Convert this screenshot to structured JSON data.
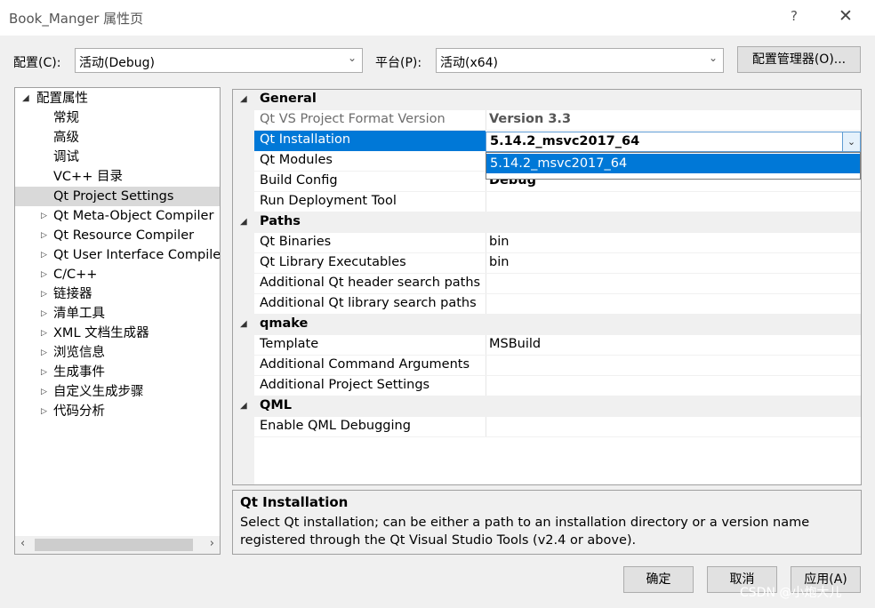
{
  "window": {
    "title": "Book_Manger 属性页",
    "help_glyph": "?",
    "close_glyph": "✕"
  },
  "config": {
    "label": "配置(C):",
    "value": "活动(Debug)"
  },
  "platform": {
    "label": "平台(P):",
    "value": "活动(x64)"
  },
  "config_manager_label": "配置管理器(O)...",
  "tree": {
    "root": "配置属性",
    "items": [
      {
        "label": "常规",
        "expandable": false
      },
      {
        "label": "高级",
        "expandable": false
      },
      {
        "label": "调试",
        "expandable": false
      },
      {
        "label": "VC++ 目录",
        "expandable": false
      },
      {
        "label": "Qt Project Settings",
        "expandable": false,
        "selected": true
      },
      {
        "label": "Qt Meta-Object Compiler",
        "expandable": true
      },
      {
        "label": "Qt Resource Compiler",
        "expandable": true
      },
      {
        "label": "Qt User Interface Compile",
        "expandable": true
      },
      {
        "label": "C/C++",
        "expandable": true
      },
      {
        "label": "链接器",
        "expandable": true
      },
      {
        "label": "清单工具",
        "expandable": true
      },
      {
        "label": "XML 文档生成器",
        "expandable": true
      },
      {
        "label": "浏览信息",
        "expandable": true
      },
      {
        "label": "生成事件",
        "expandable": true
      },
      {
        "label": "自定义生成步骤",
        "expandable": true
      },
      {
        "label": "代码分析",
        "expandable": true
      }
    ]
  },
  "grid": {
    "general": "General",
    "format_version": {
      "key": "Qt VS Project Format Version",
      "value": "Version 3.3"
    },
    "installation": {
      "key": "Qt Installation",
      "value": "5.14.2_msvc2017_64"
    },
    "modules": {
      "key": "Qt Modules",
      "value": ""
    },
    "build_config": {
      "key": "Build Config",
      "value": "Debug"
    },
    "deployment": {
      "key": "Run Deployment Tool",
      "value": ""
    },
    "paths": "Paths",
    "binaries": {
      "key": "Qt Binaries",
      "value": "bin"
    },
    "lib_exec": {
      "key": "Qt Library Executables",
      "value": "bin"
    },
    "header_paths": {
      "key": "Additional Qt header search paths",
      "value": ""
    },
    "library_paths": {
      "key": "Additional Qt library search paths",
      "value": ""
    },
    "qmake": "qmake",
    "template": {
      "key": "Template",
      "value": "MSBuild"
    },
    "cmd_args": {
      "key": "Additional Command Arguments",
      "value": ""
    },
    "proj_settings": {
      "key": "Additional Project Settings",
      "value": ""
    },
    "qml": "QML",
    "qml_debug": {
      "key": "Enable QML Debugging",
      "value": ""
    },
    "dropdown_option": "5.14.2_msvc2017_64"
  },
  "description": {
    "title": "Qt Installation",
    "text": "Select Qt installation; can be either a path to an installation directory or a version name registered through the Qt Visual Studio Tools (v2.4 or above)."
  },
  "buttons": {
    "ok": "确定",
    "cancel": "取消",
    "apply": "应用(A)"
  },
  "watermark": "CSDN @小炮大儿"
}
